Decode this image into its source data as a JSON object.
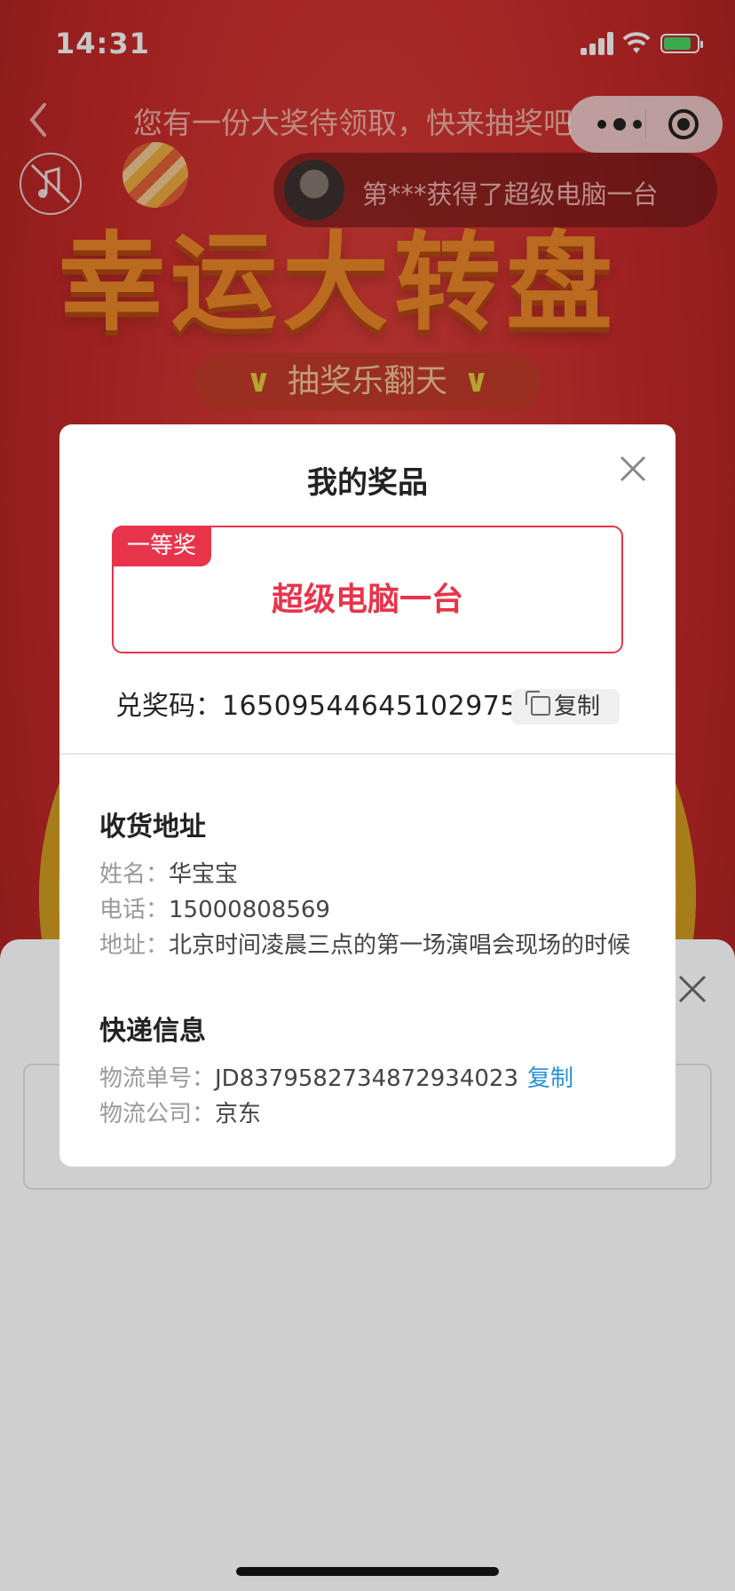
{
  "status_bar": {
    "time": "14:31"
  },
  "nav": {
    "title": "您有一份大奖待领取，快来抽奖吧"
  },
  "ticker": {
    "text": "第***获得了超级电脑一台"
  },
  "banner": {
    "title": "幸运大转盘",
    "subtitle": "抽奖乐翻天",
    "arrow": "∨"
  },
  "modal": {
    "title": "我的奖品",
    "prize": {
      "tag": "一等奖",
      "name": "超级电脑一台"
    },
    "code": {
      "label": "兑奖码：",
      "value": "1650954464510297​51",
      "copy_label": "复制"
    },
    "address": {
      "title": "收货地址",
      "name_label": "姓名：",
      "name": "华宝宝",
      "phone_label": "电话：",
      "phone": "15000808569",
      "addr_label": "地址：",
      "addr": "北京时间凌晨三点的第一场演唱会现场的时候"
    },
    "express": {
      "title": "快递信息",
      "number_label": "物流单号：",
      "number": "JD8379582734872934023",
      "copy_label": "复制",
      "company_label": "物流公司：",
      "company": "京东"
    }
  },
  "colors": {
    "accent": "#e8344a",
    "link": "#2a8fd8",
    "bg_red": "#c92a2a"
  }
}
